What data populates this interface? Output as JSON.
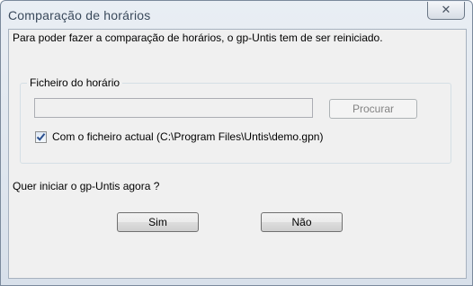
{
  "window": {
    "title": "Comparação de horários",
    "close_icon": "close-icon"
  },
  "dialog": {
    "message": "Para poder fazer a comparação de horários, o gp-Untis tem de ser reiniciado.",
    "group": {
      "legend": "Ficheiro do horário",
      "file_value": "",
      "browse_label": "Procurar",
      "checkbox_checked": true,
      "checkbox_label": "Com o ficheiro actual (C:\\Program Files\\Untis\\demo.gpn)"
    },
    "question": "Quer iniciar o gp-Untis agora ?",
    "buttons": {
      "yes_label": "Sim",
      "no_label": "Não"
    }
  }
}
